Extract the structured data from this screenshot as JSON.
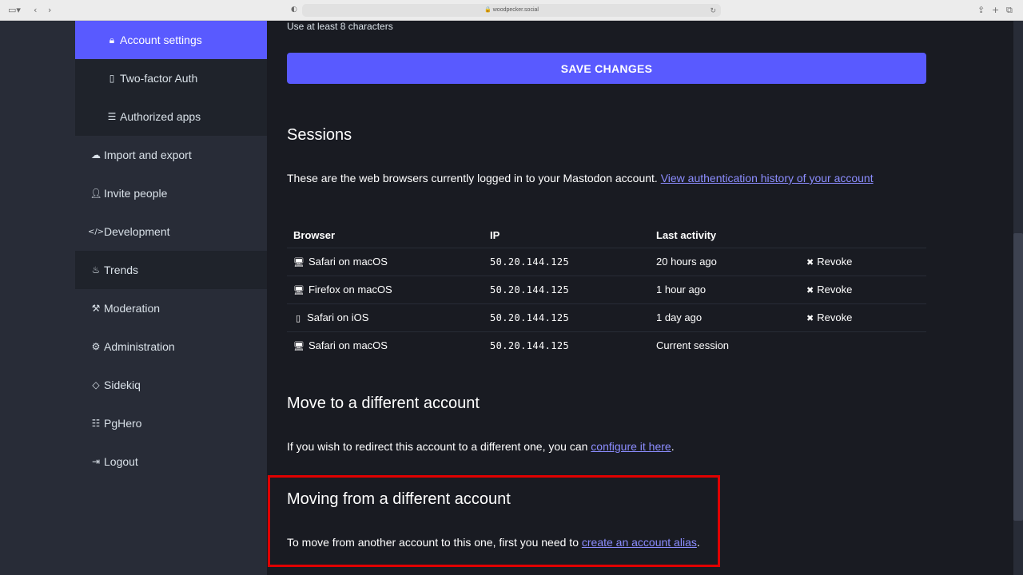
{
  "browser": {
    "url": "woodpecker.social"
  },
  "sidebar": {
    "items": [
      {
        "label": "Account settings",
        "icon": "lock-icon"
      },
      {
        "label": "Two-factor Auth",
        "icon": "mobile-icon"
      },
      {
        "label": "Authorized apps",
        "icon": "list-icon"
      },
      {
        "label": "Import and export",
        "icon": "cloud-download-icon"
      },
      {
        "label": "Invite people",
        "icon": "user-plus-icon"
      },
      {
        "label": "Development",
        "icon": "code-icon"
      },
      {
        "label": "Trends",
        "icon": "fire-icon"
      },
      {
        "label": "Moderation",
        "icon": "gavel-icon"
      },
      {
        "label": "Administration",
        "icon": "cogs-icon"
      },
      {
        "label": "Sidekiq",
        "icon": "diamond-icon"
      },
      {
        "label": "PgHero",
        "icon": "database-icon"
      },
      {
        "label": "Logout",
        "icon": "sign-out-icon"
      }
    ]
  },
  "main": {
    "password_hint": "Use at least 8 characters",
    "save_label": "SAVE CHANGES",
    "sessions": {
      "title": "Sessions",
      "description": "These are the web browsers currently logged in to your Mastodon account.",
      "history_link": "View authentication history of your account",
      "headers": [
        "Browser",
        "IP",
        "Last activity",
        ""
      ],
      "rows": [
        {
          "browser": "Safari on macOS",
          "icon": "desktop-icon",
          "ip": "50.20.144.125",
          "activity": "20 hours ago",
          "action": "Revoke"
        },
        {
          "browser": "Firefox on macOS",
          "icon": "desktop-icon",
          "ip": "50.20.144.125",
          "activity": "1 hour ago",
          "action": "Revoke"
        },
        {
          "browser": "Safari on iOS",
          "icon": "mobile-icon",
          "ip": "50.20.144.125",
          "activity": "1 day ago",
          "action": "Revoke"
        },
        {
          "browser": "Safari on macOS",
          "icon": "desktop-icon",
          "ip": "50.20.144.125",
          "activity": "Current session",
          "action": ""
        }
      ]
    },
    "move_to": {
      "title": "Move to a different account",
      "text": "If you wish to redirect this account to a different one, you can",
      "link": "configure it here",
      "suffix": "."
    },
    "move_from": {
      "title": "Moving from a different account",
      "text": "To move from another account to this one, first you need to",
      "link": "create an account alias",
      "suffix": "."
    }
  },
  "colors": {
    "accent": "#595aff",
    "link": "#8c8dff",
    "highlight": "#e00000"
  }
}
